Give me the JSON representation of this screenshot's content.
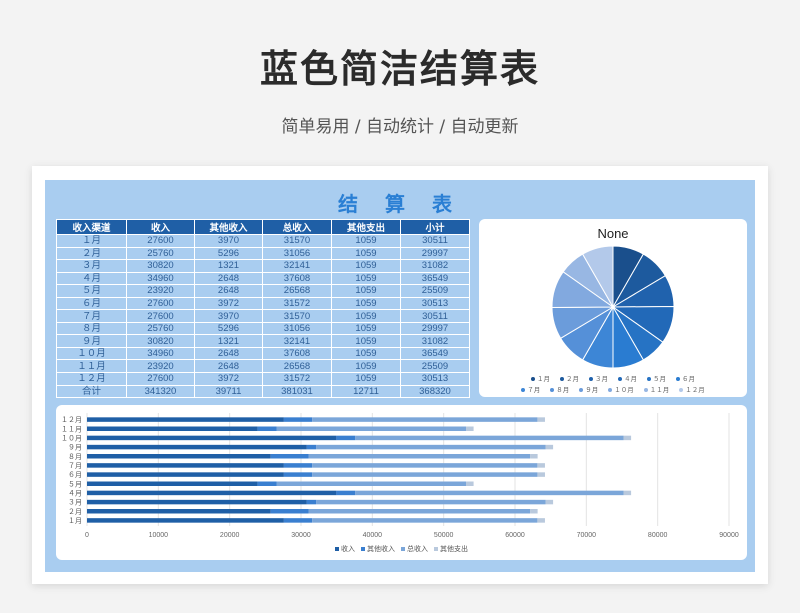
{
  "header": {
    "title": "蓝色简洁结算表",
    "subtitle": "简单易用 / 自动统计 / 自动更新"
  },
  "sheet": {
    "title": "结 算 表"
  },
  "table": {
    "columns": [
      "收入渠道",
      "收入",
      "其他收入",
      "总收入",
      "其他支出",
      "小计"
    ],
    "rows": [
      [
        "１月",
        "27600",
        "3970",
        "31570",
        "1059",
        "30511"
      ],
      [
        "２月",
        "25760",
        "5296",
        "31056",
        "1059",
        "29997"
      ],
      [
        "３月",
        "30820",
        "1321",
        "32141",
        "1059",
        "31082"
      ],
      [
        "４月",
        "34960",
        "2648",
        "37608",
        "1059",
        "36549"
      ],
      [
        "５月",
        "23920",
        "2648",
        "26568",
        "1059",
        "25509"
      ],
      [
        "６月",
        "27600",
        "3972",
        "31572",
        "1059",
        "30513"
      ],
      [
        "７月",
        "27600",
        "3970",
        "31570",
        "1059",
        "30511"
      ],
      [
        "８月",
        "25760",
        "5296",
        "31056",
        "1059",
        "29997"
      ],
      [
        "９月",
        "30820",
        "1321",
        "32141",
        "1059",
        "31082"
      ],
      [
        "１０月",
        "34960",
        "2648",
        "37608",
        "1059",
        "36549"
      ],
      [
        "１１月",
        "23920",
        "2648",
        "26568",
        "1059",
        "25509"
      ],
      [
        "１２月",
        "27600",
        "3972",
        "31572",
        "1059",
        "30513"
      ],
      [
        "合计",
        "341320",
        "39711",
        "381031",
        "12711",
        "368320"
      ]
    ]
  },
  "chart_data": [
    {
      "type": "pie",
      "title": "None",
      "categories": [
        "１月",
        "２月",
        "３月",
        "４月",
        "５月",
        "６月",
        "７月",
        "８月",
        "９月",
        "１０月",
        "１１月",
        "１２月"
      ],
      "values": [
        30511,
        29997,
        31082,
        36549,
        25509,
        30513,
        30511,
        29997,
        31082,
        36549,
        25509,
        30513
      ],
      "colors": [
        "#1a4f8c",
        "#1d5a9e",
        "#2062ad",
        "#2269b8",
        "#2673c4",
        "#2a7cd1",
        "#3d86d6",
        "#5590d8",
        "#6b9cdb",
        "#82a9df",
        "#98b7e3",
        "#b3c9ea"
      ],
      "legend": "bottom"
    },
    {
      "type": "bar",
      "orientation": "horizontal",
      "stacked": true,
      "categories": [
        "１月",
        "２月",
        "３月",
        "４月",
        "５月",
        "６月",
        "７月",
        "８月",
        "９月",
        "１０月",
        "１１月",
        "１２月"
      ],
      "series": [
        {
          "name": "收入",
          "values": [
            27600,
            25760,
            30820,
            34960,
            23920,
            27600,
            27600,
            25760,
            30820,
            34960,
            23920,
            27600
          ],
          "color": "#1f5fa6"
        },
        {
          "name": "其他收入",
          "values": [
            3970,
            5296,
            1321,
            2648,
            2648,
            3972,
            3970,
            5296,
            1321,
            2648,
            2648,
            3972
          ],
          "color": "#3a7fd0"
        },
        {
          "name": "总收入",
          "values": [
            31570,
            31056,
            32141,
            37608,
            26568,
            31572,
            31570,
            31056,
            32141,
            37608,
            26568,
            31572
          ],
          "color": "#7ba6d9"
        },
        {
          "name": "其他支出",
          "values": [
            1059,
            1059,
            1059,
            1059,
            1059,
            1059,
            1059,
            1059,
            1059,
            1059,
            1059,
            1059
          ],
          "color": "#b9c9dd"
        }
      ],
      "xlim": [
        0,
        90000
      ],
      "xticks": [
        "0",
        "10000",
        "20000",
        "30000",
        "40000",
        "50000",
        "60000",
        "70000",
        "80000",
        "90000"
      ],
      "grid": true,
      "legend": "bottom"
    }
  ]
}
